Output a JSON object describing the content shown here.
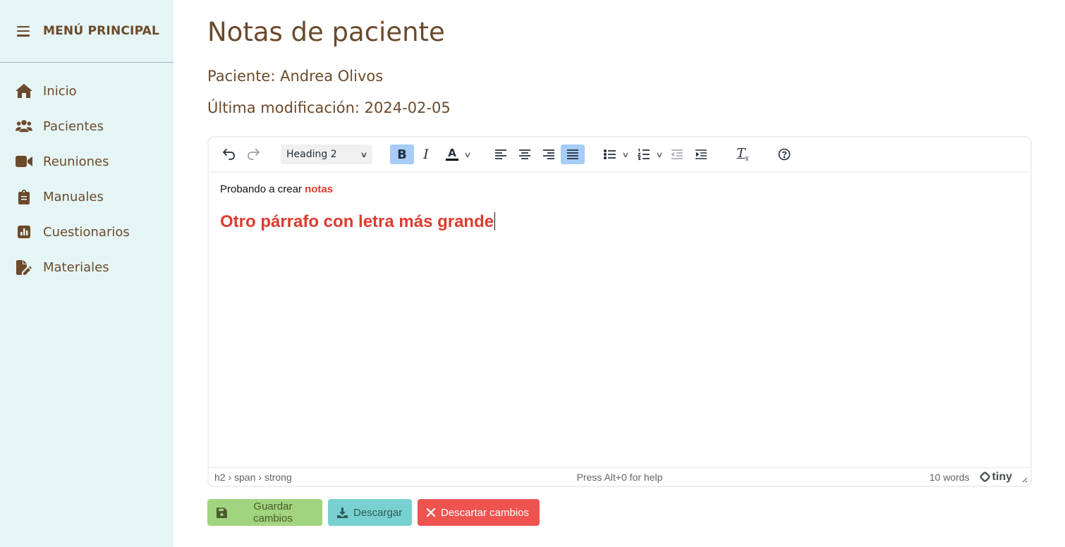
{
  "sidebar": {
    "title": "MENÚ PRINCIPAL",
    "items": [
      {
        "label": "Inicio",
        "icon": "home-icon"
      },
      {
        "label": "Pacientes",
        "icon": "users-icon"
      },
      {
        "label": "Reuniones",
        "icon": "video-camera-icon"
      },
      {
        "label": "Manuales",
        "icon": "clipboard-icon"
      },
      {
        "label": "Cuestionarios",
        "icon": "bar-chart-icon"
      },
      {
        "label": "Materiales",
        "icon": "file-pen-icon"
      }
    ]
  },
  "main": {
    "title": "Notas de paciente",
    "patient_line": "Paciente: Andrea Olivos",
    "modified_line": "Última modificación: 2024-02-05"
  },
  "editor": {
    "toolbar": {
      "block_format": "Heading 2"
    },
    "content": {
      "paragraph_text": "Probando a crear",
      "paragraph_strong": "notas",
      "heading_text": "Otro párrafo con letra más grande"
    },
    "statusbar": {
      "path": "h2 › span › strong",
      "help": "Press Alt+0 for help",
      "word_count": "10 words",
      "brand": "tiny"
    }
  },
  "actions": {
    "save": "Guardar cambios",
    "download": "Descargar",
    "discard": "Descartar cambios"
  },
  "colors": {
    "sidebar_bg": "#e5f5f5",
    "text_brown": "#6b4a2b",
    "accent_red": "#dc3b2f",
    "save_green": "#a1d47f",
    "download_teal": "#78d0d0",
    "discard_red": "#ef5350",
    "toolbar_active": "#a6ccf7"
  }
}
